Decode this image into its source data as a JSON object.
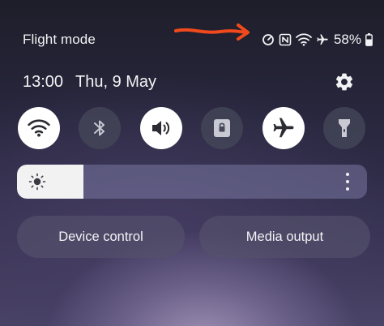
{
  "status_bar": {
    "title": "Flight mode",
    "battery_percent": "58%",
    "icons": [
      "data-saver-icon",
      "nfc-icon",
      "wifi-icon",
      "airplane-icon",
      "battery-icon"
    ]
  },
  "header": {
    "time": "13:00",
    "date": "Thu, 9 May"
  },
  "quick_toggles": [
    {
      "name": "wifi",
      "icon": "wifi-icon",
      "state": "on"
    },
    {
      "name": "bluetooth",
      "icon": "bluetooth-icon",
      "state": "off"
    },
    {
      "name": "sound",
      "icon": "speaker-icon",
      "state": "on"
    },
    {
      "name": "screen-lock",
      "icon": "lock-icon",
      "state": "off"
    },
    {
      "name": "airplane-mode",
      "icon": "airplane-icon",
      "state": "on"
    },
    {
      "name": "flashlight",
      "icon": "flashlight-icon",
      "state": "off"
    }
  ],
  "brightness": {
    "level": 0.19
  },
  "buttons": {
    "device_control": "Device control",
    "media_output": "Media output"
  },
  "colors": {
    "toggle_on": "#ffffff",
    "toggle_off": "#46485a",
    "annotation_arrow": "#f04a1c"
  }
}
